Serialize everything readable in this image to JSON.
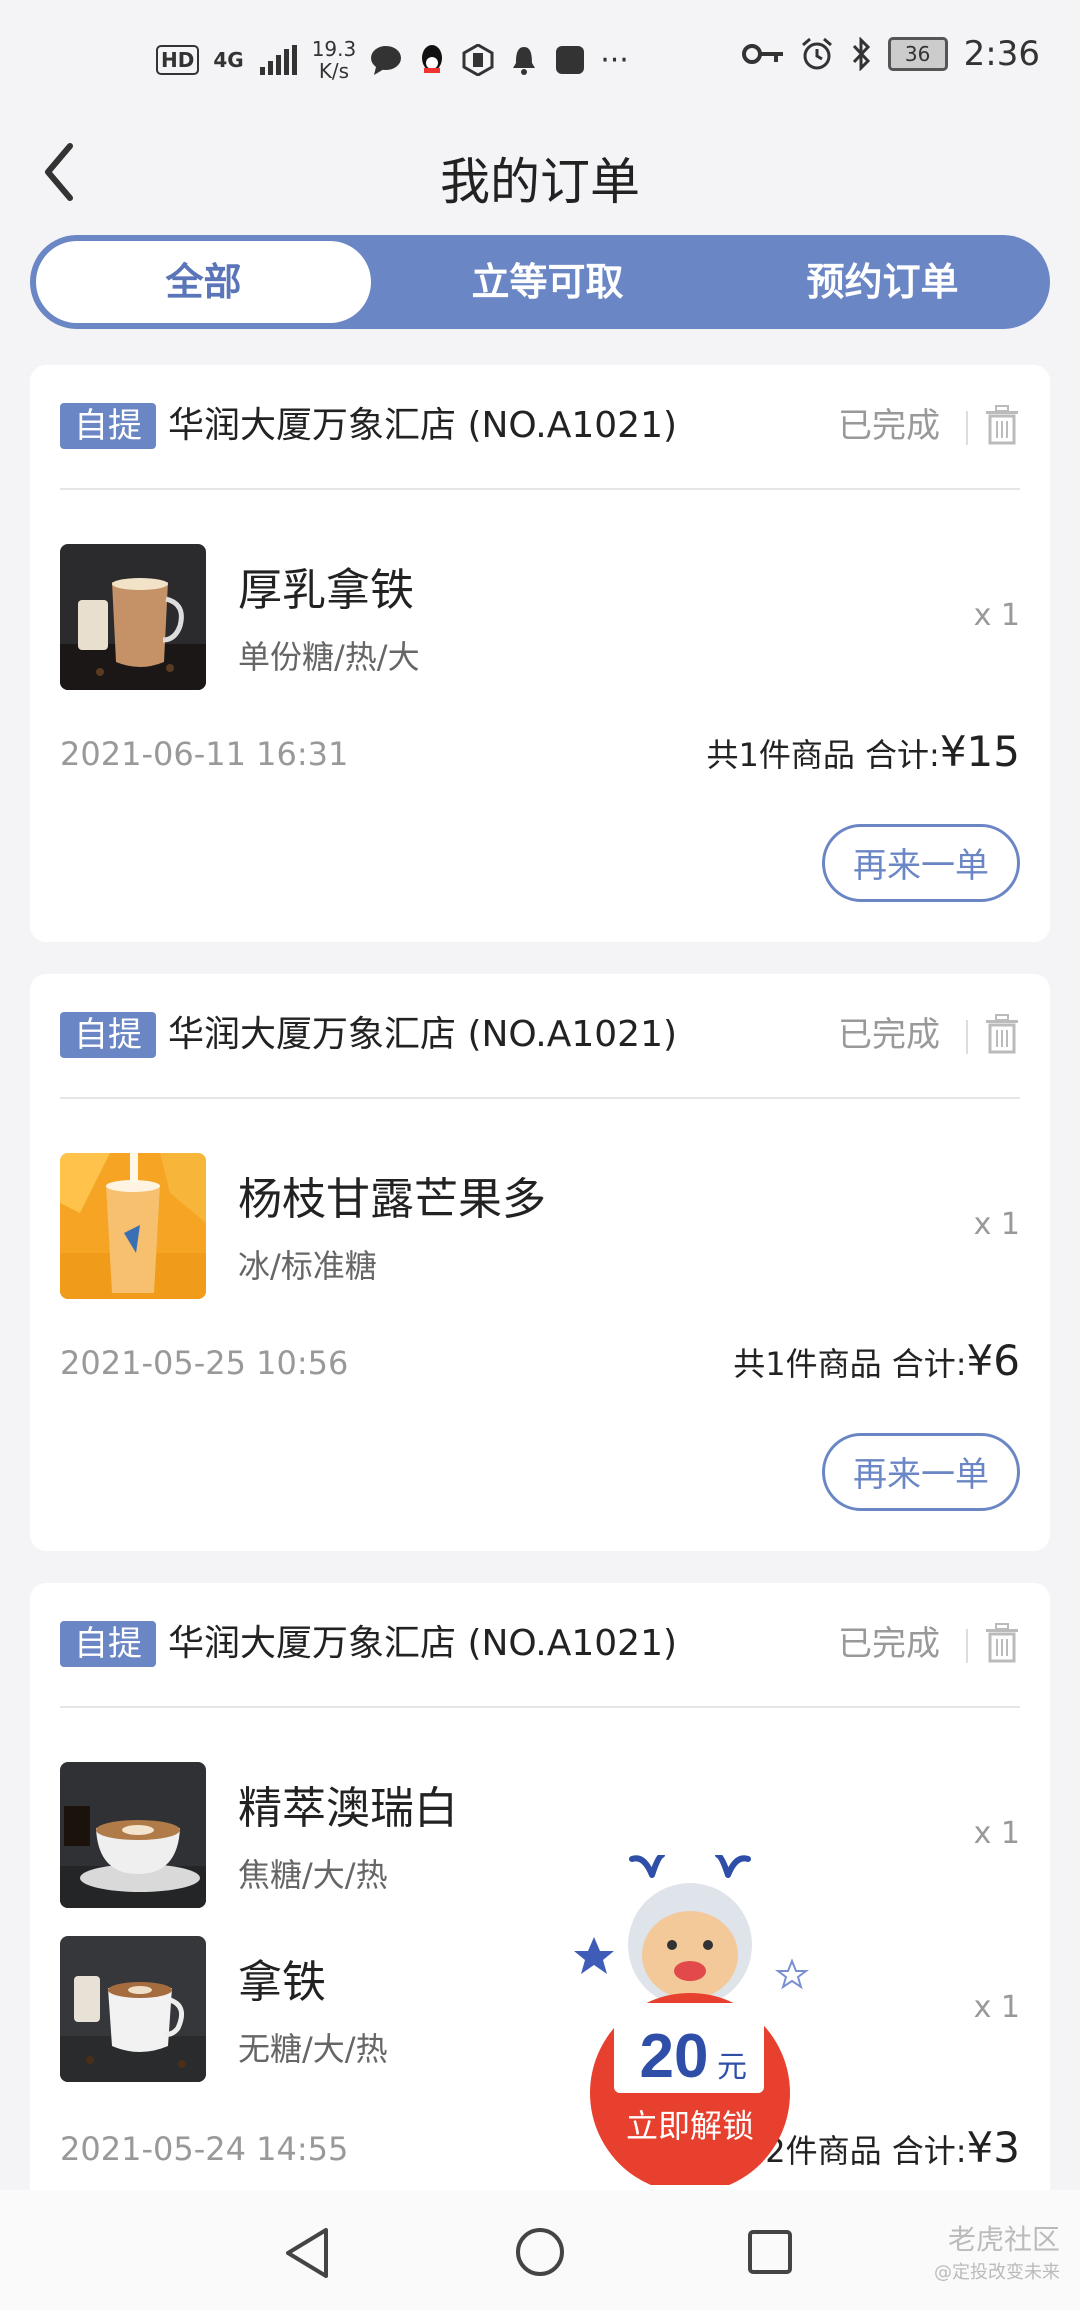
{
  "status_bar": {
    "hd": "HD",
    "network": "4G",
    "speed_value": "19.3",
    "speed_unit": "K/s",
    "battery": "36",
    "time": "2:36"
  },
  "header": {
    "title": "我的订单"
  },
  "tabs": [
    {
      "label": "全部",
      "active": true
    },
    {
      "label": "立等可取",
      "active": false
    },
    {
      "label": "预约订单",
      "active": false
    }
  ],
  "orders": [
    {
      "tag": "自提",
      "store": "华润大厦万象汇店 (NO.A1021)",
      "status": "已完成",
      "items": [
        {
          "name": "厚乳拿铁",
          "options": "单份糖/热/大",
          "qty": "x 1"
        }
      ],
      "date": "2021-06-11 16:31",
      "summary_text": "共1件商品 合计:",
      "price": "¥15",
      "reorder": "再来一单"
    },
    {
      "tag": "自提",
      "store": "华润大厦万象汇店 (NO.A1021)",
      "status": "已完成",
      "items": [
        {
          "name": "杨枝甘露芒果多",
          "options": "冰/标准糖",
          "qty": "x 1"
        }
      ],
      "date": "2021-05-25 10:56",
      "summary_text": "共1件商品 合计:",
      "price": "¥6",
      "reorder": "再来一单"
    },
    {
      "tag": "自提",
      "store": "华润大厦万象汇店 (NO.A1021)",
      "status": "已完成",
      "items": [
        {
          "name": "精萃澳瑞白",
          "options": "焦糖/大/热",
          "qty": "x 1"
        },
        {
          "name": "拿铁",
          "options": "无糖/大/热",
          "qty": "x 1"
        }
      ],
      "date": "2021-05-24 14:55",
      "summary_text": "2件商品 合计:",
      "price": "¥3"
    }
  ],
  "promo": {
    "amount": "20",
    "unit": "元",
    "label": "立即解锁"
  },
  "watermark": {
    "line1": "老虎社区",
    "line2": "@定投改变未来"
  },
  "colors": {
    "accent": "#6b86c4",
    "background": "#f4f4f6",
    "promo_red": "#e8402e"
  }
}
